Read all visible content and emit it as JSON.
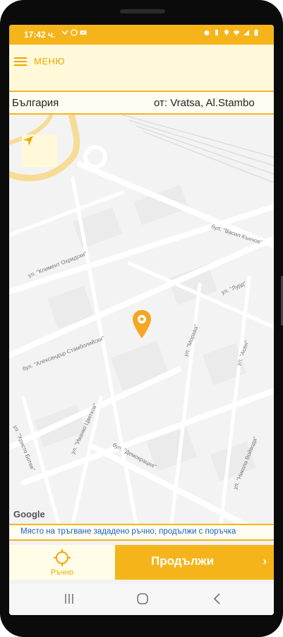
{
  "status_bar": {
    "time": "17:42 ч.",
    "left_icons": [
      "missed-call-icon",
      "whatsapp-icon",
      "youtube-icon"
    ],
    "right_icons": [
      "alarm-icon",
      "vibrate-icon",
      "location-icon",
      "wifi-icon",
      "signal-icon",
      "battery-icon"
    ]
  },
  "header": {
    "menu_label": "МЕНЮ"
  },
  "location_bar": {
    "country": "България",
    "from_text": "от: Vratsa, Al.Stambo"
  },
  "map": {
    "streets": [
      "бул. \"Васил Кънчов\"",
      "ул. \"Климент Охридски\"",
      "бул. \"Александър Стамболийски\"",
      "ул. \"Лурд\"",
      "ул. \"Морава\"",
      "ул. \"Асен\"",
      "ул. \"Христо Ботев\"",
      "ул. \"Иванко Цветков\"",
      "бул. \"Демокрация\"",
      "ул. \"Никола Войвода\""
    ],
    "attribution": "Google",
    "accent_color": "#f5b51a",
    "pin_color": "#f5a623"
  },
  "notice": {
    "text": "Място на тръгване зададено ръчно, продължи с поръчка"
  },
  "actions": {
    "manual_label": "Ръчно",
    "continue_label": "Продължи"
  },
  "nav_bar": {
    "icons": [
      "recent-apps-icon",
      "home-icon",
      "back-icon"
    ]
  }
}
